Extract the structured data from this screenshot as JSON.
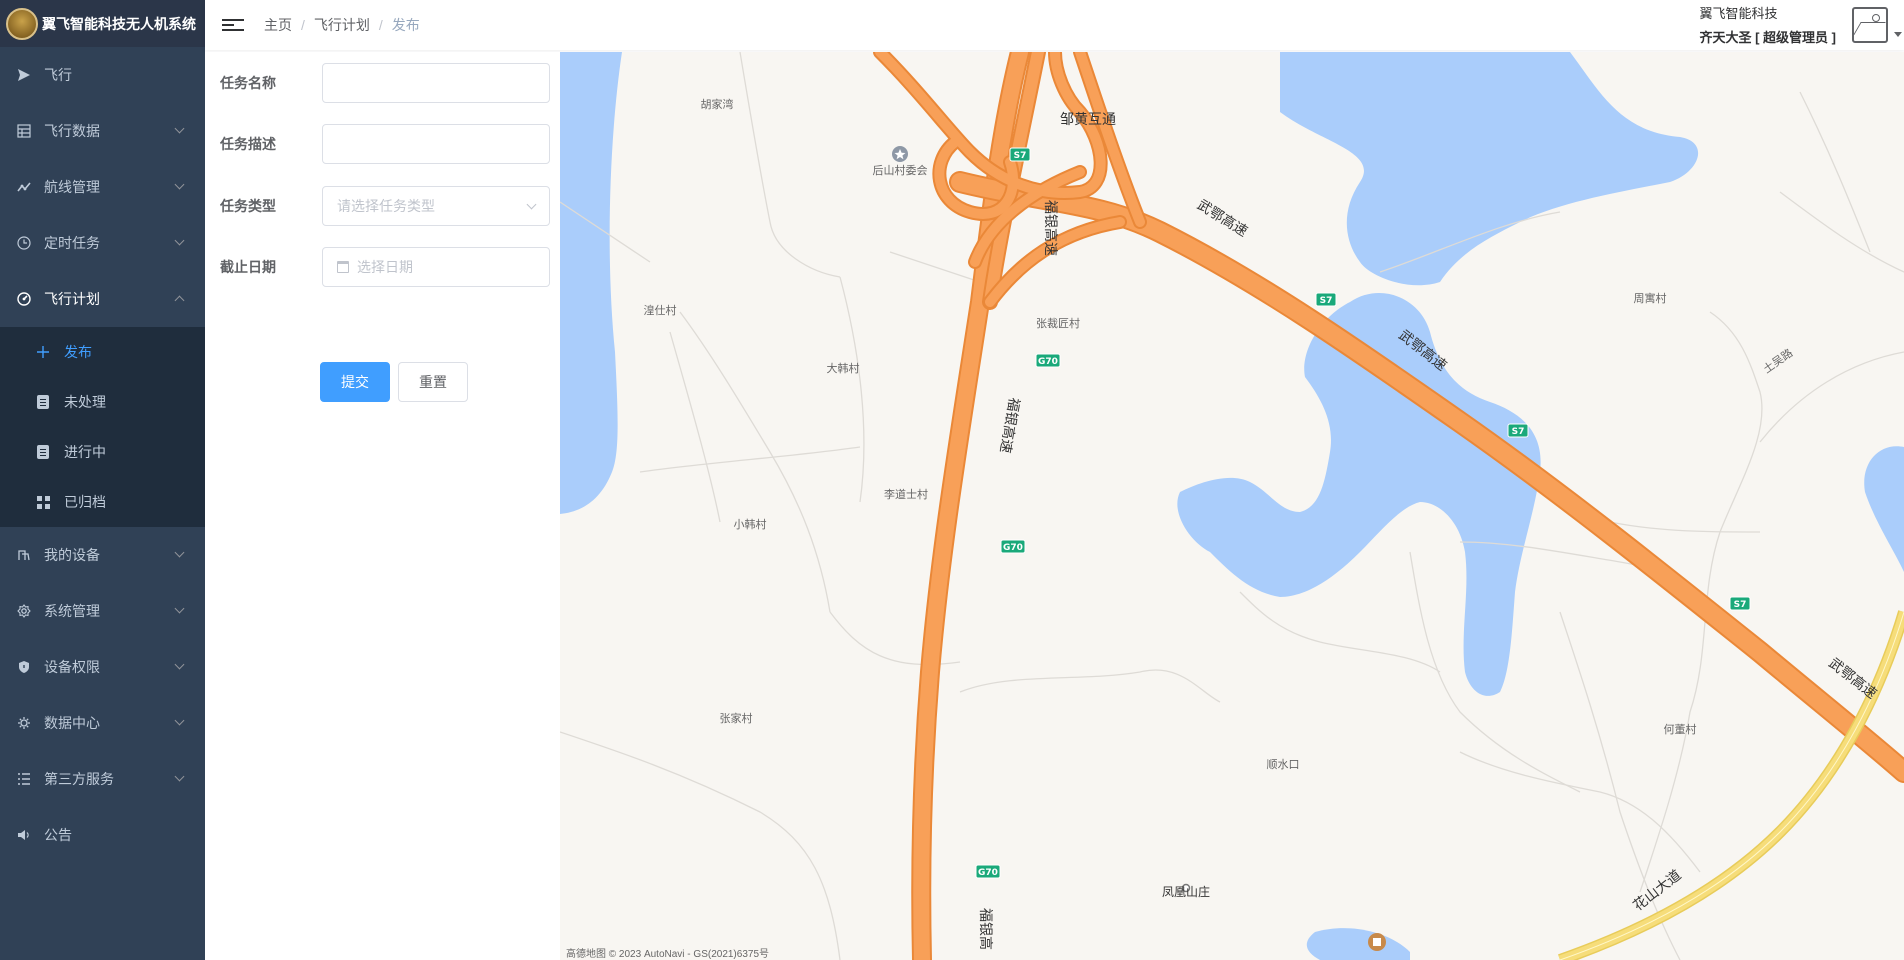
{
  "app": {
    "title": "翼飞智能科技无人机系统"
  },
  "sidebar": {
    "items": [
      {
        "label": "飞行",
        "icon": "send-icon"
      },
      {
        "label": "飞行数据",
        "icon": "table-icon"
      },
      {
        "label": "航线管理",
        "icon": "line-chart-icon"
      },
      {
        "label": "定时任务",
        "icon": "clock-icon"
      },
      {
        "label": "飞行计划",
        "icon": "gauge-icon"
      },
      {
        "label": "我的设备",
        "icon": "device-icon"
      },
      {
        "label": "系统管理",
        "icon": "gear-icon"
      },
      {
        "label": "设备权限",
        "icon": "shield-icon"
      },
      {
        "label": "数据中心",
        "icon": "cog-icon"
      },
      {
        "label": "第三方服务",
        "icon": "list-icon"
      },
      {
        "label": "公告",
        "icon": "speaker-icon"
      }
    ],
    "plan_sub": [
      {
        "label": "发布",
        "icon": "plus-icon"
      },
      {
        "label": "未处理",
        "icon": "clipboard-icon"
      },
      {
        "label": "进行中",
        "icon": "clipboard-icon"
      },
      {
        "label": "已归档",
        "icon": "grid-icon"
      }
    ]
  },
  "breadcrumb": {
    "home": "主页",
    "parent": "飞行计划",
    "current": "发布"
  },
  "user": {
    "company": "翼飞智能科技",
    "role": "齐天大圣 [ 超级管理员 ]"
  },
  "form": {
    "name_label": "任务名称",
    "name_value": "",
    "desc_label": "任务描述",
    "desc_value": "",
    "type_label": "任务类型",
    "type_placeholder": "请选择任务类型",
    "date_label": "截止日期",
    "date_placeholder": "选择日期",
    "submit_label": "提交",
    "reset_label": "重置"
  },
  "map": {
    "labels": {
      "hujiawan": "胡家湾",
      "zouhuang": "邹黄互通",
      "houshan": "后山村委会",
      "wuhe1": "武鄂高速",
      "wuhe2": "武鄂高速",
      "wuhe3": "武鄂高速",
      "fuyin1": "福银高速",
      "fuyin2": "福银高速",
      "fuyin3": "福银高",
      "huangshicun": "湟仕村",
      "zhangcaijiang": "张裁匠村",
      "dahancun": "大韩村",
      "lidaoshi": "李道士村",
      "xiaohancun": "小韩村",
      "zhoumeicun": "周寓村",
      "tuwulu": "土吴路",
      "zhangjiacun": "张家村",
      "shunshuikou": "顺水口",
      "hejiacun": "何董村",
      "fenghuang": "凤凰山庄",
      "huashan": "花山大道"
    },
    "shields": {
      "s7": "S7",
      "g70": "G70"
    },
    "copyright": "高德地图 © 2023 AutoNavi - GS(2021)6375号",
    "colors": {
      "water": "#aacdfb",
      "highway": "#f8a058",
      "highway_edge": "#ea8838",
      "avenue": "#f6dd7a",
      "shield": "#1aa97a",
      "land": "#f8f6f2"
    }
  }
}
